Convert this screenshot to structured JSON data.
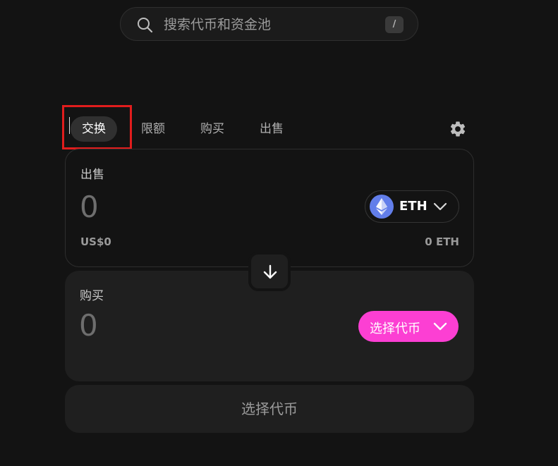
{
  "search": {
    "placeholder": "搜索代币和资金池",
    "shortcut": "/"
  },
  "tabs": [
    {
      "label": "交换",
      "active": true
    },
    {
      "label": "限额",
      "active": false
    },
    {
      "label": "购买",
      "active": false
    },
    {
      "label": "出售",
      "active": false
    }
  ],
  "sell": {
    "label": "出售",
    "amount": "0",
    "usd_value": "US$0",
    "token_symbol": "ETH",
    "balance": "0 ETH"
  },
  "buy": {
    "label": "购买",
    "amount": "0",
    "select_token_label": "选择代币"
  },
  "action_button_label": "选择代币",
  "icons": {
    "search": "search-icon",
    "settings": "gear-icon",
    "swap": "arrow-down-icon",
    "token": "eth-logo-icon",
    "dropdown": "chevron-down-icon"
  },
  "colors": {
    "background": "#131313",
    "panel": "#1f1f1f",
    "accent_pink": "#fc3fd3",
    "eth_blue": "#627eea",
    "highlight_box": "#e11d1d"
  }
}
